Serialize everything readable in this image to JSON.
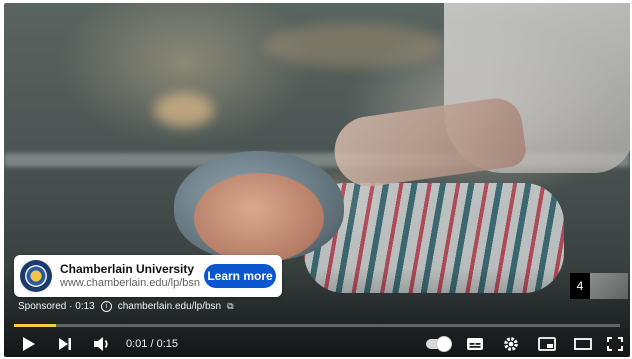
{
  "ad": {
    "advertiser": "Chamberlain University",
    "url": "www.chamberlain.edu/lp/bsn",
    "cta": "Learn more",
    "logo_icon": "university-seal-icon"
  },
  "sponsor": {
    "label": "Sponsored · 0:13",
    "link": "chamberlain.edu/lp/bsn"
  },
  "skip": {
    "count": "4"
  },
  "player": {
    "time": "0:01 / 0:15",
    "progress_fraction": 0.07,
    "accent_color": "#f7c948",
    "icons": [
      "play-icon",
      "next-icon",
      "volume-icon",
      "autoplay-toggle-icon",
      "subtitles-icon",
      "settings-icon",
      "miniplayer-icon",
      "theater-icon",
      "fullscreen-icon"
    ]
  }
}
